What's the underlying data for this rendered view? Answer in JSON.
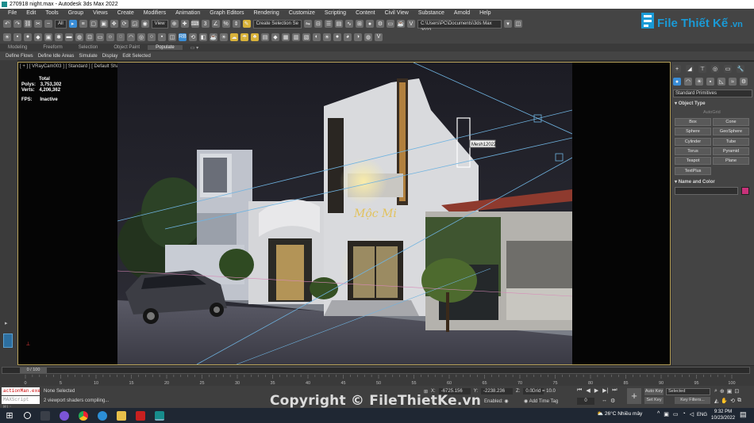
{
  "window": {
    "title": "270918 night.max - Autodesk 3ds Max 2022"
  },
  "menu": [
    "File",
    "Edit",
    "Tools",
    "Group",
    "Views",
    "Create",
    "Modifiers",
    "Animation",
    "Graph Editors",
    "Rendering",
    "Customize",
    "Scripting",
    "Content",
    "Civil View",
    "Substance",
    "Arnold",
    "Help"
  ],
  "toolbar": {
    "filter": "All",
    "view": "View",
    "selection_set": "Create Selection Se",
    "path": "C:\\Users\\PC\\Documents\\3ds Max 2022",
    "render_badge": "RB"
  },
  "ribbon": {
    "tabs": [
      "Modeling",
      "Freeform",
      "Selection",
      "Object Paint",
      "Populate"
    ],
    "active": "Populate"
  },
  "subtabs": [
    "Define Flows",
    "Define Idle Areas",
    "Simulate",
    "Display",
    "Edit Selected"
  ],
  "viewport": {
    "label": "[ + ] [ VRayCam003 ] [ Standard ] [ Default Shading ]",
    "stats_total": "Total",
    "polys_label": "Polys:",
    "polys_value": "3,753,302",
    "verts_label": "Verts:",
    "verts_value": "4,206,362",
    "fps_label": "FPS:",
    "fps_value": "Inactive",
    "tooltip": "Mesh12022",
    "sign_text": "Mộc Mi"
  },
  "command_panel": {
    "dropdown": "Standard Primitives",
    "rollout_object_type": "Object Type",
    "autogrid": "AutoGrid",
    "buttons": [
      "Box",
      "Cone",
      "Sphere",
      "GeoSphere",
      "Cylinder",
      "Tube",
      "Torus",
      "Pyramid",
      "Teapot",
      "Plane",
      "TextPlus"
    ],
    "rollout_name_color": "Name and Color",
    "color": "#c8327a"
  },
  "timeline": {
    "frame": "0 / 100",
    "ticks": [
      "0",
      "5",
      "10",
      "15",
      "20",
      "25",
      "30",
      "35",
      "40",
      "45",
      "50",
      "55",
      "60",
      "65",
      "70",
      "75",
      "80",
      "85",
      "90",
      "95",
      "100"
    ]
  },
  "status": {
    "script_line1": "actionMan.exe",
    "script_line2": "MAXScript Mi:",
    "selected": "None Selected",
    "message": "2 viewport shaders compiling...",
    "x_label": "X:",
    "x_value": "-6725.156",
    "y_label": "Y:",
    "y_value": "-2238.236",
    "z_label": "Z:",
    "z_value": "0.0",
    "grid": "Grid = 10.0",
    "enabled": "Enabled:",
    "add_time_tag": "Add Time Tag",
    "auto_key": "Auto Key",
    "set_key": "Set Key",
    "selected_dd": "Selected",
    "key_filters": "Key Filters...",
    "frame_field": "0"
  },
  "taskbar": {
    "weather": "26°C  Nhiều mây",
    "lang": "ENG",
    "time": "9:32 PM",
    "date": "10/23/2022"
  },
  "watermark": "Copyright © FileThietKe.vn",
  "logo": {
    "brand": "File Thiết Kế",
    "suffix": ".vn"
  }
}
